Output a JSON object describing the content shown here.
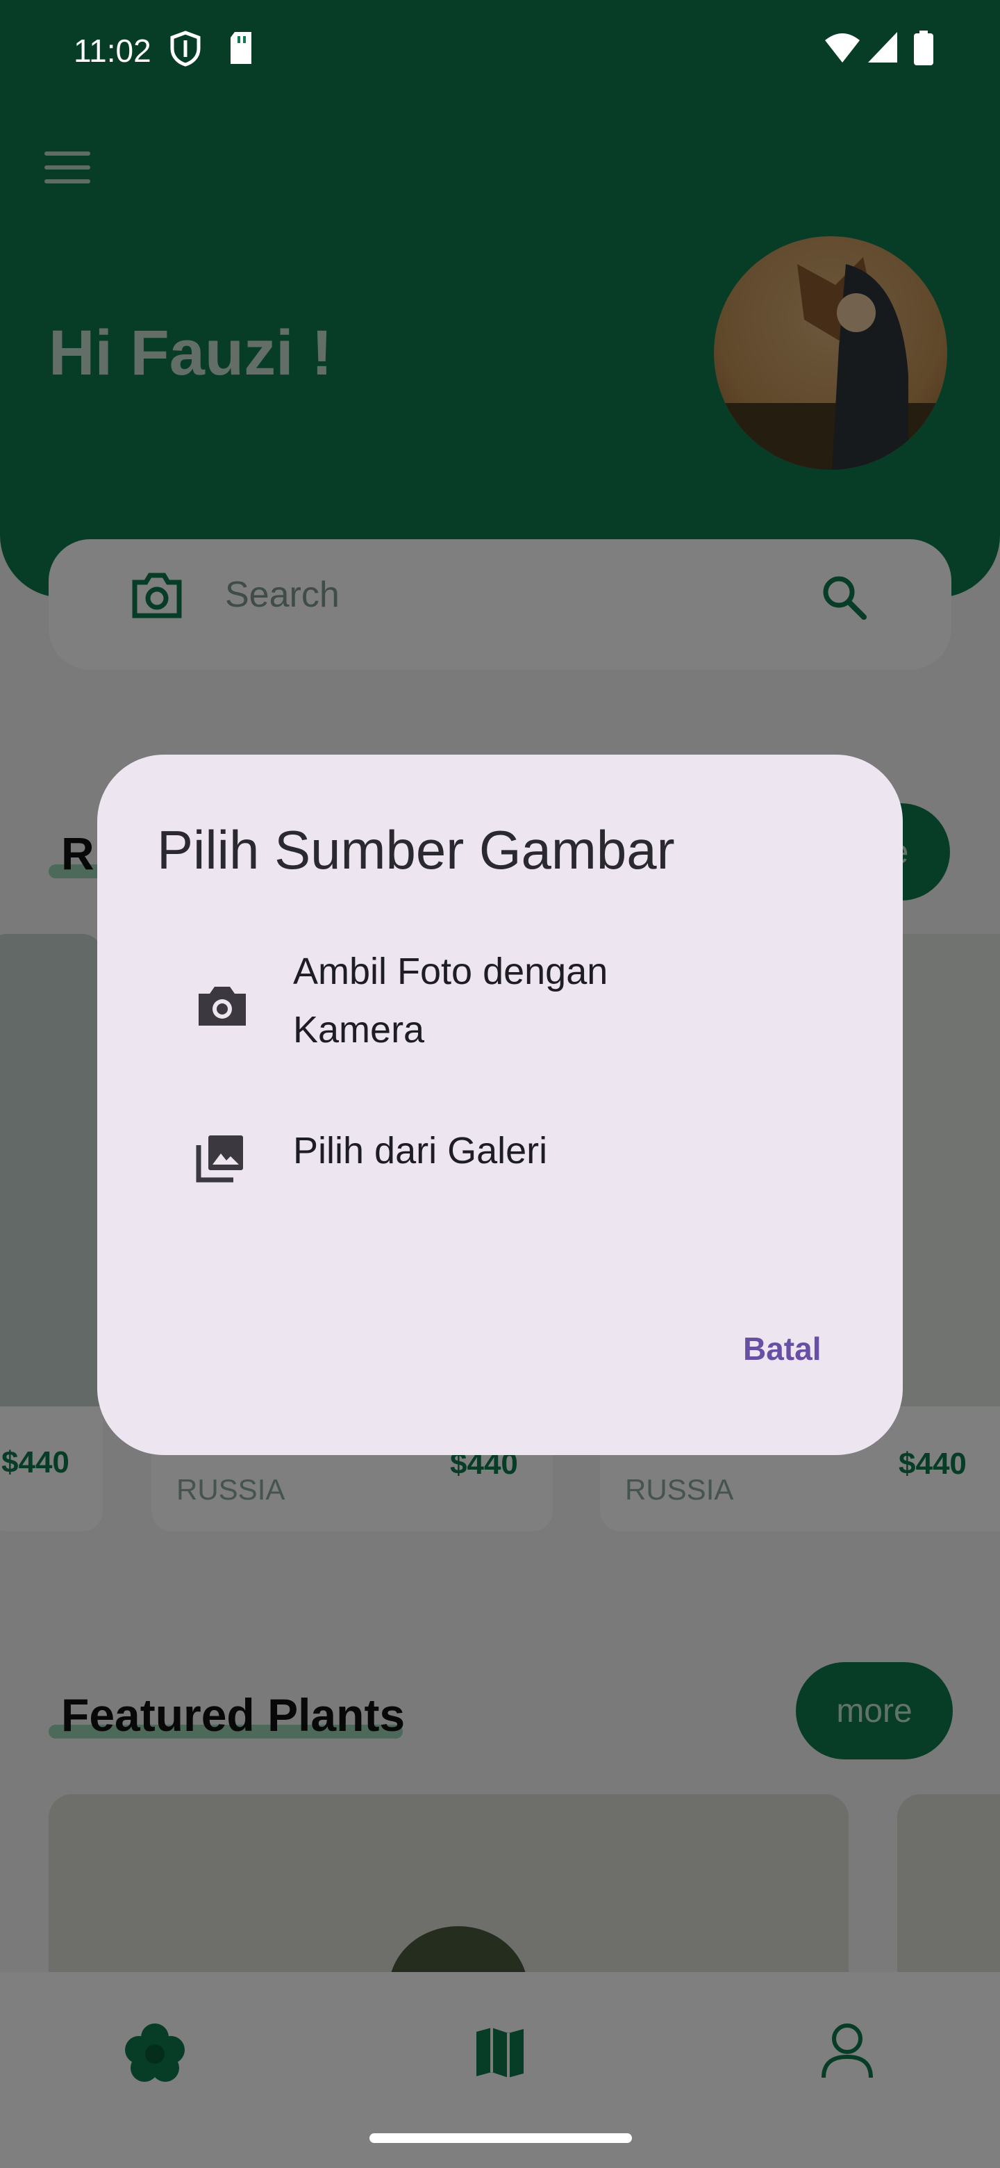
{
  "status_bar": {
    "time": "11:02"
  },
  "header": {
    "greeting": "Hi Fauzi !"
  },
  "search": {
    "placeholder": "Search"
  },
  "sections": {
    "recommended": {
      "title_fragment": "R",
      "more_fragment": "e"
    },
    "featured": {
      "title": "Featured Plants",
      "more_label": "more"
    }
  },
  "cards": [
    {
      "price": "$440",
      "origin": ""
    },
    {
      "price": "$440",
      "origin": "RUSSIA"
    },
    {
      "price": "$440",
      "origin": "RUSSIA"
    }
  ],
  "dialog": {
    "title": "Pilih Sumber Gambar",
    "options": [
      {
        "label": "Ambil Foto dengan Kamera",
        "icon": "camera-icon"
      },
      {
        "label": "Pilih dari Galeri",
        "icon": "photo-library-icon"
      }
    ],
    "cancel_label": "Batal"
  },
  "bottom_nav": {
    "items": [
      {
        "icon": "plant-icon"
      },
      {
        "icon": "map-icon"
      },
      {
        "icon": "profile-icon"
      }
    ]
  },
  "colors": {
    "primary": "#0f7a4d",
    "dialog_bg": "#ede5f0",
    "accent": "#6750a4"
  }
}
